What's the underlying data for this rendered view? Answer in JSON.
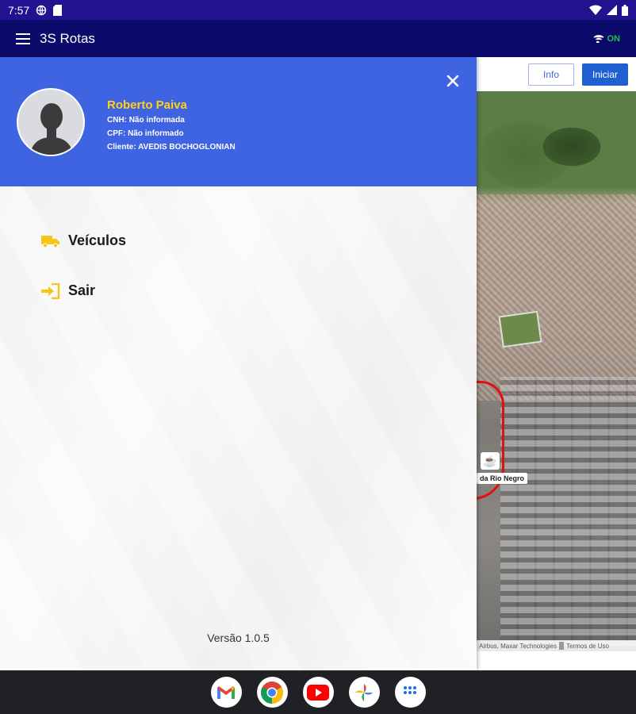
{
  "status_bar": {
    "time": "7:57"
  },
  "app_bar": {
    "title": "3S Rotas",
    "connection_status": "ON"
  },
  "map": {
    "info_button": "Info",
    "start_button": "Iniciar",
    "poi_label": "da Rio Negro",
    "credits": [
      "Airbus, Maxar Technologies",
      "Termos de Uso"
    ]
  },
  "drawer": {
    "profile": {
      "name": "Roberto Paiva",
      "cnh": "CNH: Não informada",
      "cpf": "CPF: Não informado",
      "client": "Cliente: AVEDIS BOCHOGLONIAN"
    },
    "menu": [
      {
        "label": "Veículos",
        "icon": "truck-icon"
      },
      {
        "label": "Sair",
        "icon": "logout-icon"
      }
    ],
    "version": "Versão 1.0.5"
  },
  "dock": [
    "gmail",
    "chrome",
    "youtube",
    "photos",
    "app-drawer"
  ],
  "colors": {
    "status_bar": "#21138f",
    "app_bar": "#0b0a6a",
    "drawer_header": "#3e64e2",
    "accent_yellow": "#ffd21a",
    "online_green": "#19c34b"
  }
}
